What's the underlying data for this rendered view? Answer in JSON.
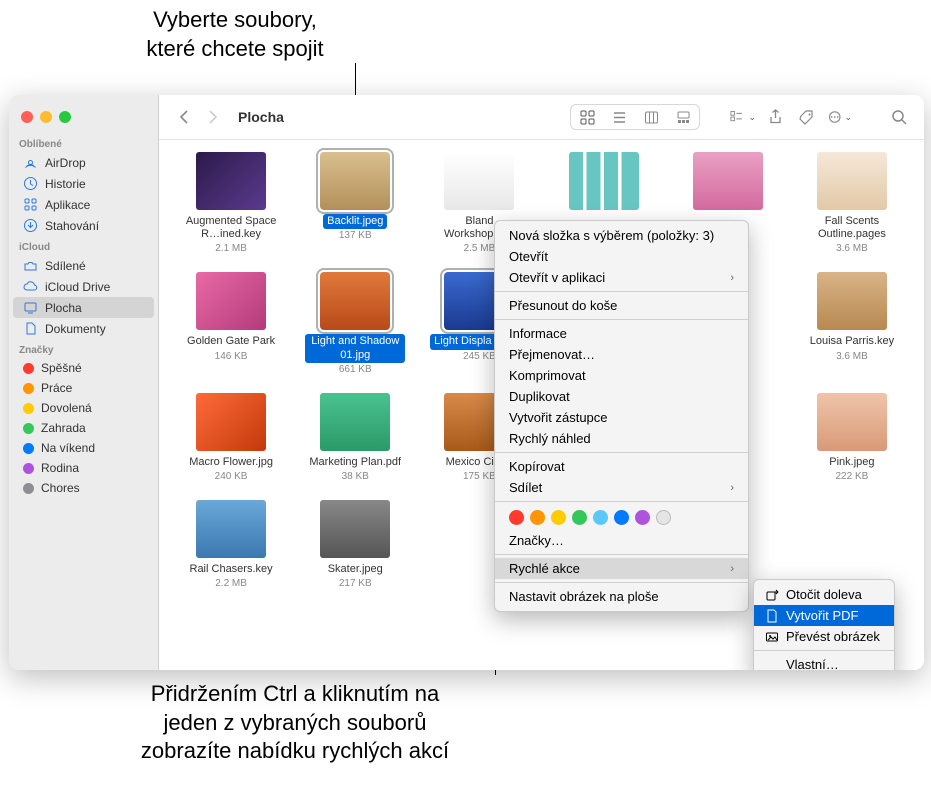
{
  "callouts": {
    "top": "Vyberte soubory,\nkteré chcete spojit",
    "bottom": "Přidržením Ctrl a kliknutím na\njeden z vybraných souborů\nzobrazíte nabídku rychlých akcí"
  },
  "window": {
    "title": "Plocha"
  },
  "sidebar": {
    "sections": [
      {
        "header": "Oblíbené",
        "items": [
          {
            "icon": "airdrop",
            "label": "AirDrop"
          },
          {
            "icon": "clock",
            "label": "Historie"
          },
          {
            "icon": "apps",
            "label": "Aplikace"
          },
          {
            "icon": "download",
            "label": "Stahování"
          }
        ]
      },
      {
        "header": "iCloud",
        "items": [
          {
            "icon": "shared",
            "label": "Sdílené"
          },
          {
            "icon": "cloud",
            "label": "iCloud Drive"
          },
          {
            "icon": "desktop",
            "label": "Plocha",
            "selected": true
          },
          {
            "icon": "doc",
            "label": "Dokumenty"
          }
        ]
      },
      {
        "header": "Značky",
        "items": [
          {
            "tag": "#ff3b30",
            "label": "Spěšné"
          },
          {
            "tag": "#ff9500",
            "label": "Práce"
          },
          {
            "tag": "#ffcc00",
            "label": "Dovolená"
          },
          {
            "tag": "#34c759",
            "label": "Zahrada"
          },
          {
            "tag": "#007aff",
            "label": "Na víkend"
          },
          {
            "tag": "#af52de",
            "label": "Rodina"
          },
          {
            "tag": "#8e8e93",
            "label": "Chores"
          }
        ]
      }
    ]
  },
  "files": [
    {
      "name": "Augmented Space R…ined.key",
      "size": "2.1 MB",
      "thumb": "aug"
    },
    {
      "name": "Backlit.jpeg",
      "size": "137 KB",
      "thumb": "backlit",
      "selected": true
    },
    {
      "name": "Bland Workshop.pag",
      "size": "2.5 MB",
      "thumb": "bland"
    },
    {
      "name": "",
      "size": "",
      "thumb": "bars"
    },
    {
      "name": "",
      "size": "",
      "thumb": "pink"
    },
    {
      "name": "Fall Scents Outline.pages",
      "size": "3.6 MB",
      "thumb": "fall"
    },
    {
      "name": "Golden Gate Park",
      "size": "146 KB",
      "thumb": "gg"
    },
    {
      "name": "Light and Shadow 01.jpg",
      "size": "661 KB",
      "thumb": "ls1",
      "selected": true
    },
    {
      "name": "Light Displa 01.jpg",
      "size": "245 KB",
      "thumb": "ls2",
      "selected": true
    },
    {
      "name": "",
      "size": "",
      "thumb": ""
    },
    {
      "name": "",
      "size": "",
      "thumb": ""
    },
    {
      "name": "Louisa Parris.key",
      "size": "3.6 MB",
      "thumb": "lp"
    },
    {
      "name": "Macro Flower.jpg",
      "size": "240 KB",
      "thumb": "mf"
    },
    {
      "name": "Marketing Plan.pdf",
      "size": "38 KB",
      "thumb": "mp"
    },
    {
      "name": "Mexico City.jp",
      "size": "175 KB",
      "thumb": "mc"
    },
    {
      "name": "",
      "size": "",
      "thumb": ""
    },
    {
      "name": "",
      "size": "",
      "thumb": ""
    },
    {
      "name": "Pink.jpeg",
      "size": "222 KB",
      "thumb": "pk"
    },
    {
      "name": "Rail Chasers.key",
      "size": "2.2 MB",
      "thumb": "rc"
    },
    {
      "name": "Skater.jpeg",
      "size": "217 KB",
      "thumb": "sk"
    }
  ],
  "context_menu": {
    "items": [
      {
        "label": "Nová složka s výběrem (položky: 3)"
      },
      {
        "label": "Otevřít"
      },
      {
        "label": "Otevřít v aplikaci",
        "sub": true
      },
      {
        "sep": true
      },
      {
        "label": "Přesunout do koše"
      },
      {
        "sep": true
      },
      {
        "label": "Informace"
      },
      {
        "label": "Přejmenovat…"
      },
      {
        "label": "Komprimovat"
      },
      {
        "label": "Duplikovat"
      },
      {
        "label": "Vytvořit zástupce"
      },
      {
        "label": "Rychlý náhled"
      },
      {
        "sep": true
      },
      {
        "label": "Kopírovat"
      },
      {
        "label": "Sdílet",
        "sub": true
      },
      {
        "sep": true
      },
      {
        "tags": true
      },
      {
        "label": "Značky…"
      },
      {
        "sep": true
      },
      {
        "label": "Rychlé akce",
        "sub": true,
        "hl": true
      },
      {
        "sep": true
      },
      {
        "label": "Nastavit obrázek na ploše"
      }
    ],
    "tag_colors": [
      "#ff3b30",
      "#ff9500",
      "#ffcc00",
      "#34c759",
      "#5ac8fa",
      "#007aff",
      "#af52de",
      "#e5e5e5"
    ]
  },
  "submenu": {
    "items": [
      {
        "icon": "rotate",
        "label": "Otočit doleva"
      },
      {
        "icon": "pdf",
        "label": "Vytvořit PDF",
        "hl": true
      },
      {
        "icon": "convert",
        "label": "Převést obrázek"
      },
      {
        "sep": true
      },
      {
        "label": "Vlastní…"
      }
    ]
  }
}
